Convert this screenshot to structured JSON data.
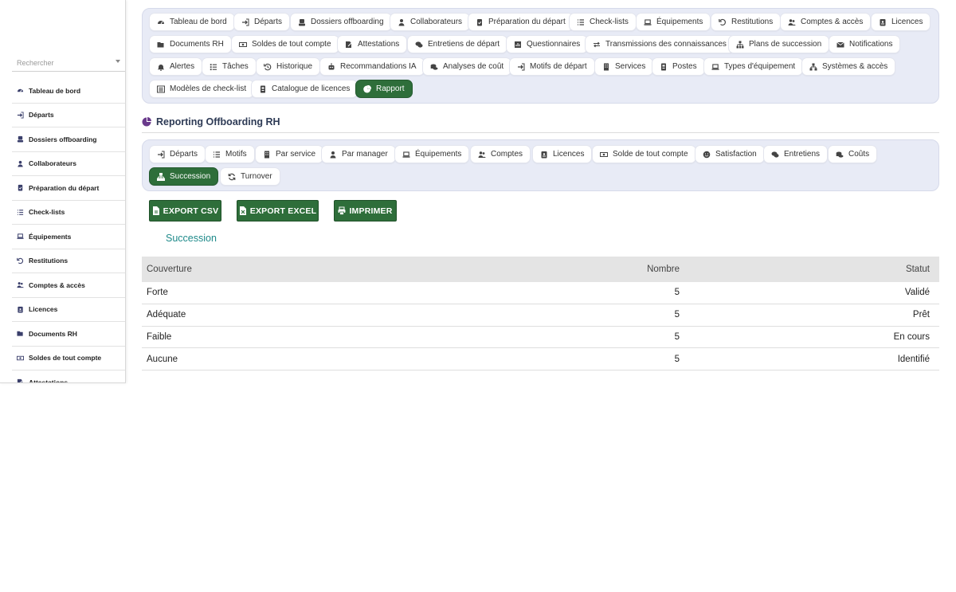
{
  "sidebar": {
    "search_placeholder": "Rechercher",
    "items": [
      {
        "label": "Tableau de bord",
        "icon": "dashboard-icon"
      },
      {
        "label": "Départs",
        "icon": "exit-icon"
      },
      {
        "label": "Dossiers offboarding",
        "icon": "user-tie-icon"
      },
      {
        "label": "Collaborateurs",
        "icon": "user-icon"
      },
      {
        "label": "Préparation du départ",
        "icon": "clipboard-check-icon"
      },
      {
        "label": "Check-lists",
        "icon": "list-icon"
      },
      {
        "label": "Équipements",
        "icon": "laptop-icon"
      },
      {
        "label": "Restitutions",
        "icon": "undo-icon"
      },
      {
        "label": "Comptes & accès",
        "icon": "users-icon"
      },
      {
        "label": "Licences",
        "icon": "id-badge-icon"
      },
      {
        "label": "Documents RH",
        "icon": "folder-open-icon"
      },
      {
        "label": "Soldes de tout compte",
        "icon": "money-bill-icon"
      },
      {
        "label": "Attestations",
        "icon": "file-signature-icon"
      }
    ]
  },
  "topnav": {
    "items": [
      {
        "label": "Tableau de bord",
        "icon": "dashboard-icon"
      },
      {
        "label": "Départs",
        "icon": "exit-icon"
      },
      {
        "label": "Dossiers offboarding",
        "icon": "user-tie-icon"
      },
      {
        "label": "Collaborateurs",
        "icon": "user-icon"
      },
      {
        "label": "Préparation du départ",
        "icon": "clipboard-check-icon"
      },
      {
        "label": "Check-lists",
        "icon": "list-icon"
      },
      {
        "label": "Équipements",
        "icon": "laptop-icon"
      },
      {
        "label": "Restitutions",
        "icon": "undo-icon"
      },
      {
        "label": "Comptes & accès",
        "icon": "users-icon"
      },
      {
        "label": "Licences",
        "icon": "id-badge-icon"
      },
      {
        "label": "Documents RH",
        "icon": "folder-open-icon"
      },
      {
        "label": "Soldes de tout compte",
        "icon": "money-bill-icon"
      },
      {
        "label": "Attestations",
        "icon": "file-signature-icon"
      },
      {
        "label": "Entretiens de départ",
        "icon": "comments-icon"
      },
      {
        "label": "Questionnaires",
        "icon": "poll-icon"
      },
      {
        "label": "Transmissions des connaissances",
        "icon": "exchange-icon"
      },
      {
        "label": "Plans de succession",
        "icon": "sitemap-icon"
      },
      {
        "label": "Notifications",
        "icon": "envelope-icon"
      },
      {
        "label": "Alertes",
        "icon": "bell-icon"
      },
      {
        "label": "Tâches",
        "icon": "tasks-icon"
      },
      {
        "label": "Historique",
        "icon": "history-icon"
      },
      {
        "label": "Recommandations IA",
        "icon": "robot-icon"
      },
      {
        "label": "Analyses de coût",
        "icon": "coins-icon"
      },
      {
        "label": "Motifs de départ",
        "icon": "exit-icon"
      },
      {
        "label": "Services",
        "icon": "building-icon"
      },
      {
        "label": "Postes",
        "icon": "id-card-icon"
      },
      {
        "label": "Types d'équipement",
        "icon": "laptop-icon"
      },
      {
        "label": "Systèmes & accès",
        "icon": "network-icon"
      },
      {
        "label": "Modèles de check-list",
        "icon": "list-alt-icon"
      },
      {
        "label": "Catalogue de licences",
        "icon": "id-card-icon"
      },
      {
        "label": "Rapport",
        "icon": "chart-pie-icon",
        "active": true
      }
    ]
  },
  "page_title": "Reporting Offboarding RH",
  "subnav": {
    "items": [
      {
        "label": "Départs",
        "icon": "exit-icon"
      },
      {
        "label": "Motifs",
        "icon": "list-icon"
      },
      {
        "label": "Par service",
        "icon": "building-icon"
      },
      {
        "label": "Par manager",
        "icon": "user-icon"
      },
      {
        "label": "Équipements",
        "icon": "laptop-icon"
      },
      {
        "label": "Comptes",
        "icon": "users-icon"
      },
      {
        "label": "Licences",
        "icon": "id-badge-icon"
      },
      {
        "label": "Solde de tout compte",
        "icon": "money-bill-icon"
      },
      {
        "label": "Satisfaction",
        "icon": "smile-icon"
      },
      {
        "label": "Entretiens",
        "icon": "comments-icon"
      },
      {
        "label": "Coûts",
        "icon": "coins-icon"
      },
      {
        "label": "Succession",
        "icon": "sitemap-icon",
        "active": true
      },
      {
        "label": "Turnover",
        "icon": "sync-icon"
      }
    ]
  },
  "actions": {
    "export_csv": "EXPORT CSV",
    "export_excel": "EXPORT EXCEL",
    "print": "IMPRIMER"
  },
  "section_title": "Succession",
  "table": {
    "headers": [
      "Couverture",
      "Nombre",
      "Statut"
    ],
    "rows": [
      [
        "Forte",
        "5",
        "Validé"
      ],
      [
        "Adéquate",
        "5",
        "Prêt"
      ],
      [
        "Faible",
        "5",
        "En cours"
      ],
      [
        "Aucune",
        "5",
        "Identifié"
      ]
    ]
  },
  "colors": {
    "accent_green": "#2e6e3a",
    "nav_bg": "#e8ebf6",
    "section_title": "#1e8a8a",
    "title_text": "#2d3a55"
  }
}
